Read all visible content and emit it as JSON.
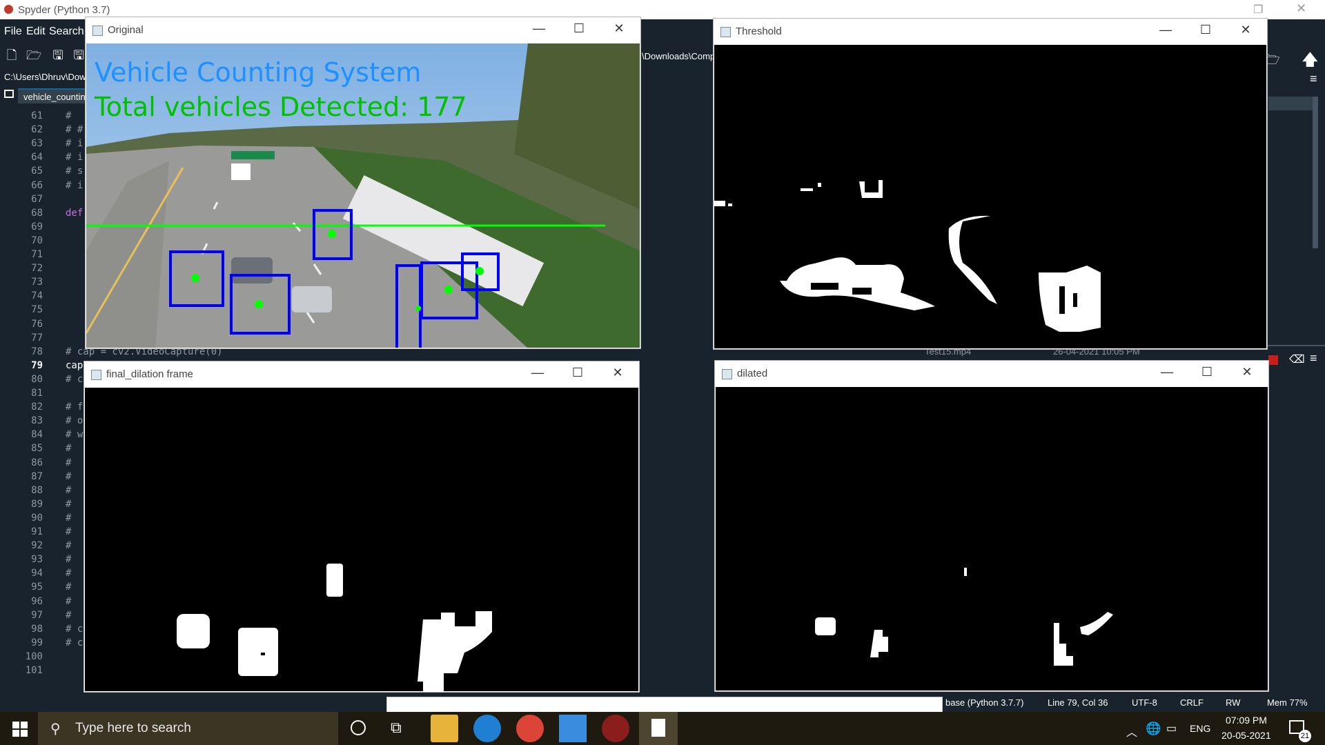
{
  "app": {
    "title": "Spyder (Python 3.7)"
  },
  "menu": [
    "File",
    "Edit",
    "Search"
  ],
  "editor": {
    "path": "C:\\Users\\Dhruv\\Dow",
    "tab": "vehicle_countin",
    "explorer_path": "\\Downloads\\Comp",
    "lines": [
      {
        "n": "61",
        "code": "#"
      },
      {
        "n": "62",
        "code": "# #"
      },
      {
        "n": "63",
        "code": "# i"
      },
      {
        "n": "64",
        "code": "# i"
      },
      {
        "n": "65",
        "code": "# s"
      },
      {
        "n": "66",
        "code": "# i"
      },
      {
        "n": "67",
        "code": ""
      },
      {
        "n": "68",
        "code": "def"
      },
      {
        "n": "69",
        "code": ""
      },
      {
        "n": "70",
        "code": ""
      },
      {
        "n": "71",
        "code": ""
      },
      {
        "n": "72",
        "code": ""
      },
      {
        "n": "73",
        "code": ""
      },
      {
        "n": "74",
        "code": ""
      },
      {
        "n": "75",
        "code": ""
      },
      {
        "n": "76",
        "code": ""
      },
      {
        "n": "77",
        "code": ""
      },
      {
        "n": "78",
        "code": "# cap = cv2.VideoCapture(0)"
      },
      {
        "n": "79",
        "code": "cap"
      },
      {
        "n": "80",
        "code": "# c"
      },
      {
        "n": "81",
        "code": ""
      },
      {
        "n": "82",
        "code": "# f"
      },
      {
        "n": "83",
        "code": "# o"
      },
      {
        "n": "84",
        "code": "# w"
      },
      {
        "n": "85",
        "code": "#"
      },
      {
        "n": "86",
        "code": "#"
      },
      {
        "n": "87",
        "code": "#"
      },
      {
        "n": "88",
        "code": "#"
      },
      {
        "n": "89",
        "code": "#"
      },
      {
        "n": "90",
        "code": "#"
      },
      {
        "n": "91",
        "code": "#"
      },
      {
        "n": "92",
        "code": "#"
      },
      {
        "n": "93",
        "code": "#"
      },
      {
        "n": "94",
        "code": "#"
      },
      {
        "n": "95",
        "code": "#"
      },
      {
        "n": "96",
        "code": "#"
      },
      {
        "n": "97",
        "code": "#"
      },
      {
        "n": "98",
        "code": "# c"
      },
      {
        "n": "99",
        "code": "# c"
      },
      {
        "n": "100",
        "code": ""
      },
      {
        "n": "101",
        "code": ""
      }
    ],
    "current_line": "79",
    "file_row": {
      "name": "Test15.mp4",
      "date": "26-04-2021 10:05 PM"
    }
  },
  "status": {
    "env": "base (Python 3.7.7)",
    "cursor": "Line 79, Col 36",
    "encoding": "UTF-8",
    "eol": "CRLF",
    "mode": "RW",
    "mem": "Mem 77%"
  },
  "windows": {
    "original": {
      "title": "Original",
      "overlay_title": "Vehicle Counting System",
      "overlay_count": "Total vehicles Detected: 177"
    },
    "threshold": {
      "title": "Threshold"
    },
    "final_dilation": {
      "title": "final_dilation frame"
    },
    "dilated": {
      "title": "dilated"
    }
  },
  "taskbar": {
    "search_placeholder": "Type here to search",
    "language": "ENG",
    "time": "07:09 PM",
    "date": "20-05-2021",
    "notifications": "21"
  },
  "colors": {
    "overlay_title": "#1e90ff",
    "overlay_count": "#00c000",
    "box": "#0000ff",
    "line": "#00ff00",
    "spyder_bg": "#19232d"
  }
}
